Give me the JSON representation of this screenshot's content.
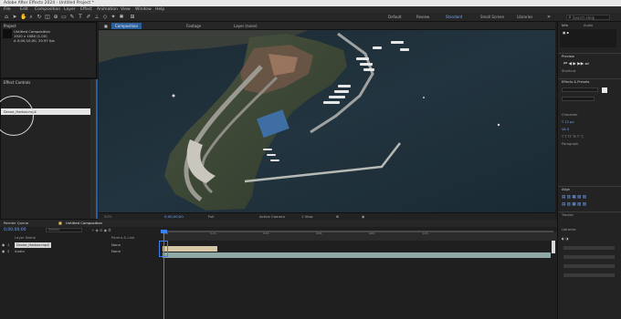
{
  "window": {
    "title": "Adobe After Effects 2024 - Untitled Project *"
  },
  "menu": {
    "items": [
      "File",
      "Edit",
      "Composition",
      "Layer",
      "Effect",
      "Animation",
      "View",
      "Window",
      "Help"
    ]
  },
  "toolbar": {
    "workspaces": [
      "Default",
      "Review",
      "Learn",
      "Standard",
      "Small Screen",
      "Libraries"
    ],
    "active_workspace": "Standard",
    "search_placeholder": "Search Help"
  },
  "project_panel": {
    "tab": "Project",
    "info_line1": "Untitled Composition",
    "info_line2": "1920 x 1080 (1.00)",
    "info_line3": "Δ 0;00;10;00, 29.97 fps"
  },
  "effects_panel": {
    "tab": "Effect Controls",
    "selected_row": "Drone_Harbor.mp4"
  },
  "comp_tabs": {
    "active": "Composition",
    "tab2": "Footage",
    "tab3": "Layer (none)",
    "breadcrumb": "Untitled Composition"
  },
  "viewer_bar": {
    "zoom": "50%",
    "time": "0;00;00;00",
    "resolution": "Full",
    "camera": "Active Camera",
    "view": "1 View"
  },
  "right_panel": {
    "info": "Info",
    "audio": "Audio",
    "preview_label": "Preview",
    "shortcut": "Shortcut",
    "effects_presets": "Effects & Presets",
    "align": "Align",
    "character": "Character",
    "paragraph": "Paragraph",
    "tracker": "Tracker",
    "libraries": "Libraries"
  },
  "timeline": {
    "tab_render": "Render Queue",
    "tab_comp": "Untitled Composition",
    "timecode": "0;00;00;00",
    "search_placeholder": "Search",
    "col_layer_name": "Layer Name",
    "col_parent": "Parent & Link",
    "layers": [
      {
        "index": "1",
        "name": "Drone_Harbor.mp4",
        "parent": "None"
      },
      {
        "index": "2",
        "name": "Audio",
        "parent": "None"
      }
    ],
    "ruler_marks": [
      "0s",
      "02s",
      "04s",
      "06s",
      "08s",
      "10s"
    ]
  },
  "colors": {
    "accent": "#3b7ff0",
    "layer_bar": "#8fa9a7",
    "tab_active": "#2d5f9a"
  }
}
